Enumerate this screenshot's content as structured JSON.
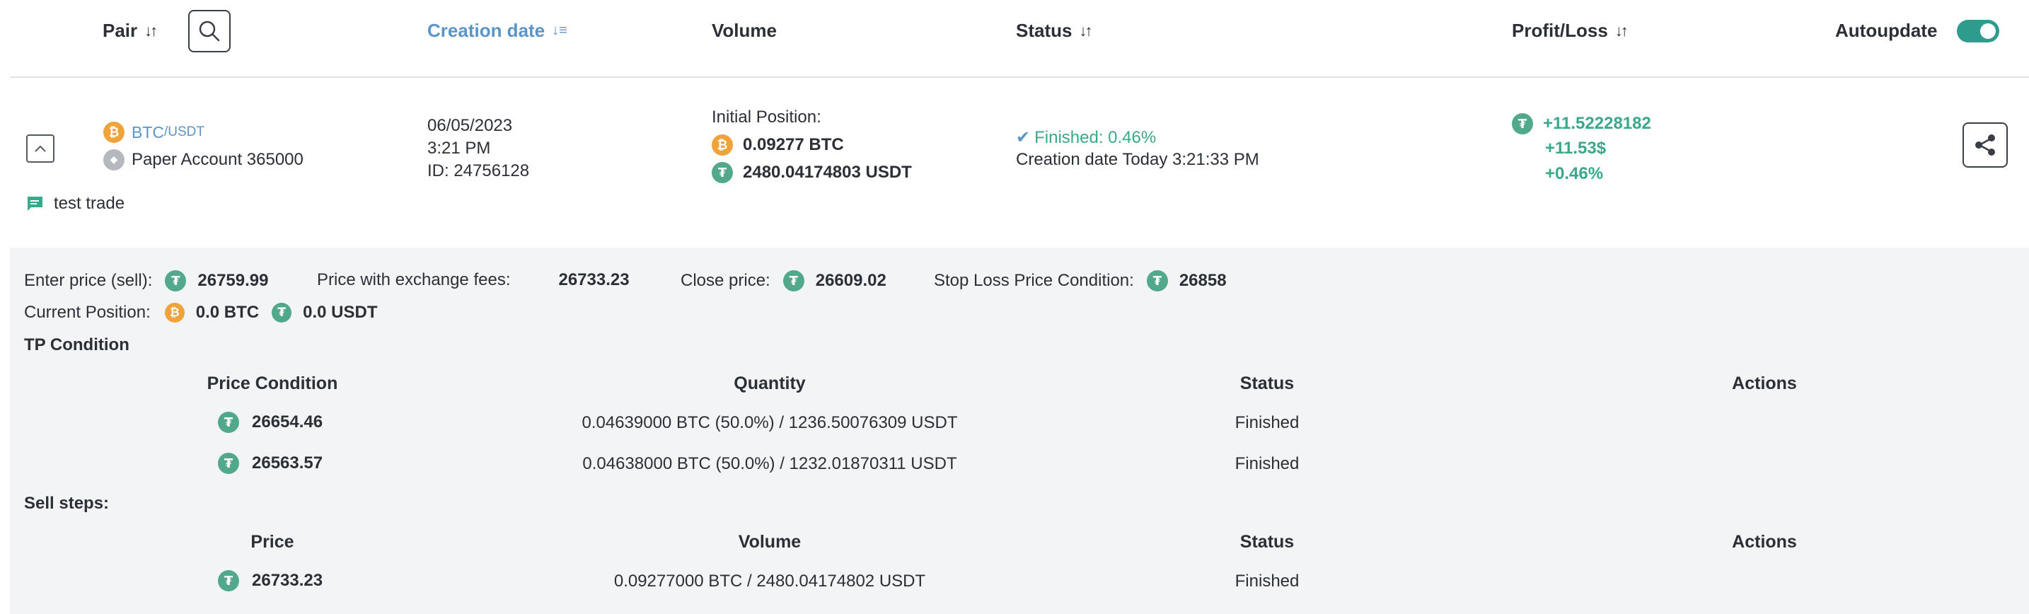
{
  "header": {
    "pair_label": "Pair",
    "creation_date_label": "Creation date",
    "volume_label": "Volume",
    "status_label": "Status",
    "profit_loss_label": "Profit/Loss",
    "autoupdate_label": "Autoupdate",
    "autoupdate_on": true
  },
  "trade": {
    "pair_base": "BTC",
    "pair_quote": "/USDT",
    "account": "Paper Account 365000",
    "comment": "test trade",
    "date": "06/05/2023",
    "time": "3:21 PM",
    "id": "ID: 24756128",
    "initial_position_label": "Initial Position:",
    "initial_btc": "0.09277 BTC",
    "initial_usdt": "2480.04174803 USDT",
    "status_text": "Finished: 0.46%",
    "status_creation": "Creation date Today 3:21:33 PM",
    "profit_usdt": "+11.52228182",
    "profit_usd": "+11.53$",
    "profit_pct": "+0.46%"
  },
  "details": {
    "enter_price_label": "Enter price (sell):",
    "enter_price": "26759.99",
    "fees_price_label": "Price with exchange fees:",
    "fees_price": "26733.23",
    "close_price_label": "Close price:",
    "close_price": "26609.02",
    "stop_loss_label": "Stop Loss Price Condition:",
    "stop_loss": "26858",
    "current_position_label": "Current Position:",
    "current_btc": "0.0 BTC",
    "current_usdt": "0.0 USDT"
  },
  "tp": {
    "title": "TP Condition",
    "columns": [
      "Price Condition",
      "Quantity",
      "Status",
      "Actions"
    ],
    "rows": [
      {
        "price": "26654.46",
        "quantity": "0.04639000 BTC (50.0%) / 1236.50076309 USDT",
        "status": "Finished"
      },
      {
        "price": "26563.57",
        "quantity": "0.04638000 BTC (50.0%) / 1232.01870311 USDT",
        "status": "Finished"
      }
    ]
  },
  "sell": {
    "title": "Sell steps:",
    "columns": [
      "Price",
      "Volume",
      "Status",
      "Actions"
    ],
    "rows": [
      {
        "price": "26733.23",
        "volume": "0.09277000 BTC / 2480.04174802 USDT",
        "status": "Finished"
      }
    ]
  },
  "icons": {
    "btc": "bitcoin-icon",
    "usdt": "tether-icon",
    "search": "search-icon",
    "share": "share-icon",
    "comment": "comment-icon",
    "check": "check-icon",
    "expand": "chevron-up-icon"
  },
  "colors": {
    "accent_blue": "#5b95c8",
    "profit_green": "#3aa88a",
    "toggle_teal": "#2d9c8c",
    "btc_orange": "#f0a33a",
    "usdt_green": "#52a88a",
    "panel_bg": "#f3f4f6"
  }
}
